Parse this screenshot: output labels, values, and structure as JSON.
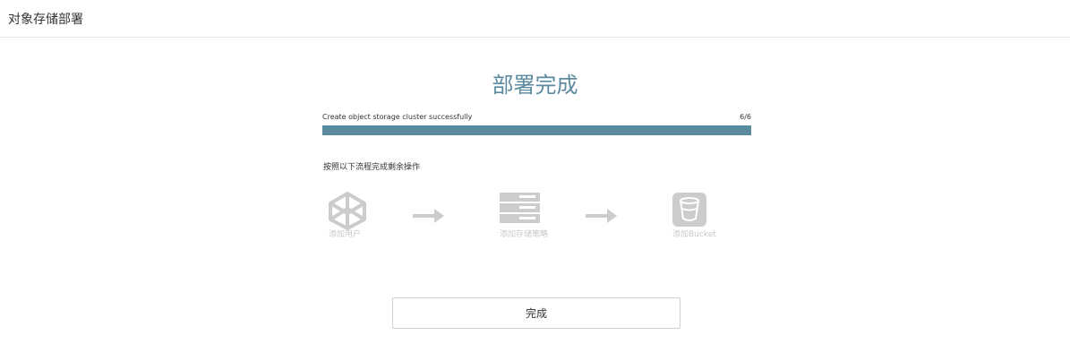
{
  "header": {
    "title": "对象存储部署"
  },
  "status": {
    "title": "部署完成",
    "message": "Create object storage cluster successfully",
    "counter": "6/6",
    "progress_fraction": 1.0,
    "progress_color": "#5a8a9e"
  },
  "steps": {
    "heading": "按照以下流程完成剩余操作",
    "items": [
      {
        "label": "添加用户",
        "icon": "cube-icon"
      },
      {
        "label": "添加存储策略",
        "icon": "server-stack-icon"
      },
      {
        "label": "添加Bucket",
        "icon": "bucket-icon"
      }
    ],
    "icon_color": "#cccccc"
  },
  "actions": {
    "finish_label": "完成"
  }
}
